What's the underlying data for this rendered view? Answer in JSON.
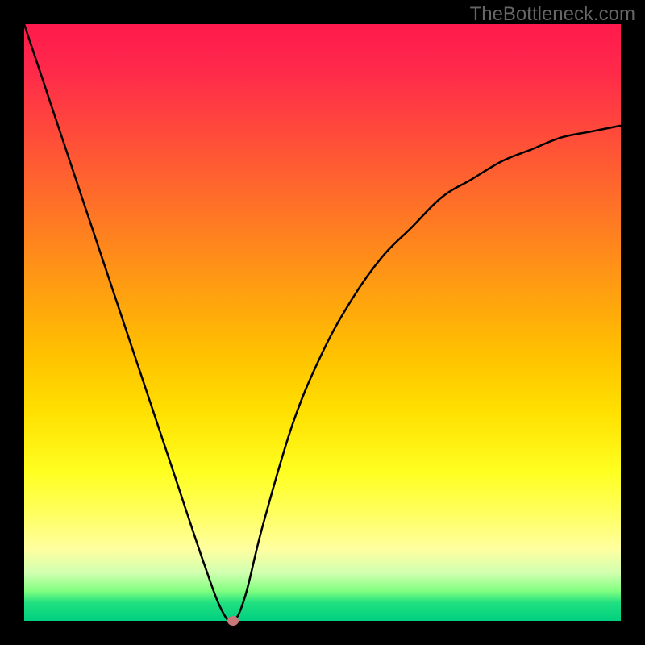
{
  "watermark": "TheBottleneck.com",
  "chart_data": {
    "type": "line",
    "title": "",
    "xlabel": "",
    "ylabel": "",
    "xlim": [
      0,
      100
    ],
    "ylim": [
      0,
      100
    ],
    "x": [
      0,
      5,
      10,
      15,
      20,
      25,
      30,
      33,
      35,
      37,
      40,
      45,
      50,
      55,
      60,
      65,
      70,
      75,
      80,
      85,
      90,
      95,
      100
    ],
    "values": [
      100,
      85,
      70,
      55,
      40,
      25,
      10,
      2,
      0,
      4,
      16,
      33,
      45,
      54,
      61,
      66,
      71,
      74,
      77,
      79,
      81,
      82,
      83
    ],
    "gradient_stops": [
      {
        "pos": 0,
        "color": "#ff1a4d"
      },
      {
        "pos": 50,
        "color": "#ffc000"
      },
      {
        "pos": 80,
        "color": "#ffff60"
      },
      {
        "pos": 100,
        "color": "#00d080"
      }
    ],
    "marker": {
      "x": 35,
      "y": 0,
      "color": "#c9787a"
    }
  }
}
